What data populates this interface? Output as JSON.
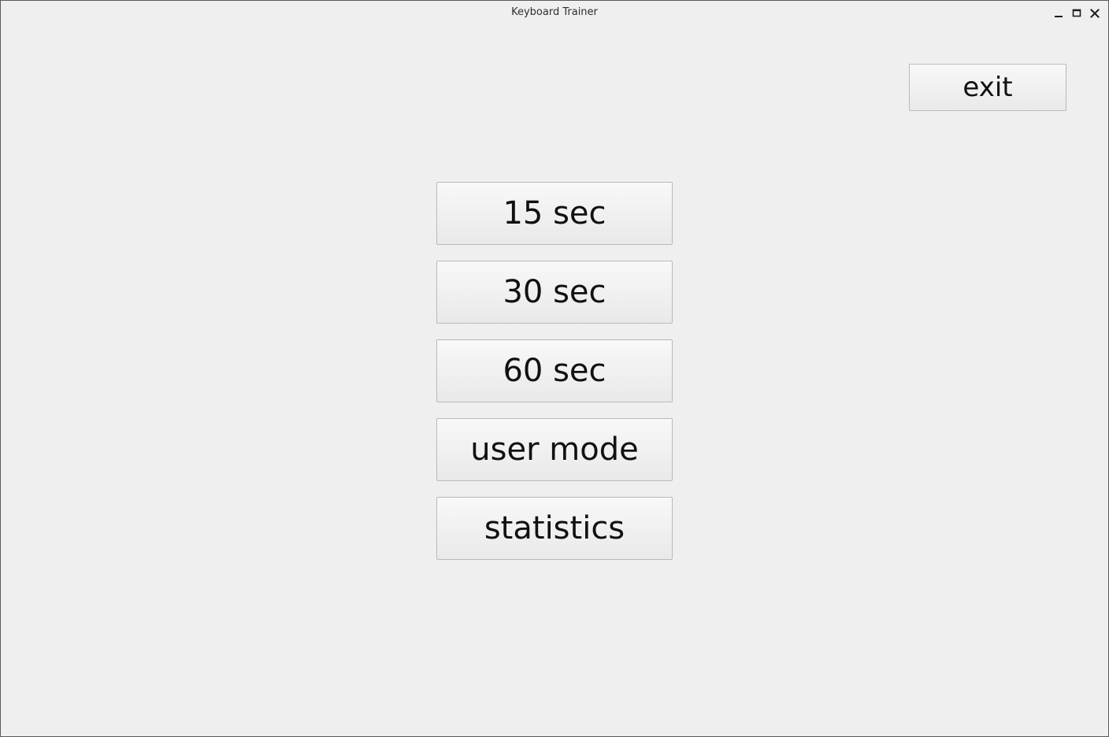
{
  "window": {
    "title": "Keyboard Trainer",
    "controls": [
      "minimize-icon",
      "maximize-icon",
      "close-icon"
    ]
  },
  "toolbar": {
    "exit_label": "exit"
  },
  "menu": {
    "items": [
      {
        "label": "15 sec"
      },
      {
        "label": "30 sec"
      },
      {
        "label": "60 sec"
      },
      {
        "label": "user mode"
      },
      {
        "label": "statistics"
      }
    ]
  },
  "colors": {
    "background": "#efefef",
    "button_border": "#b9b9b9",
    "text": "#111111"
  }
}
